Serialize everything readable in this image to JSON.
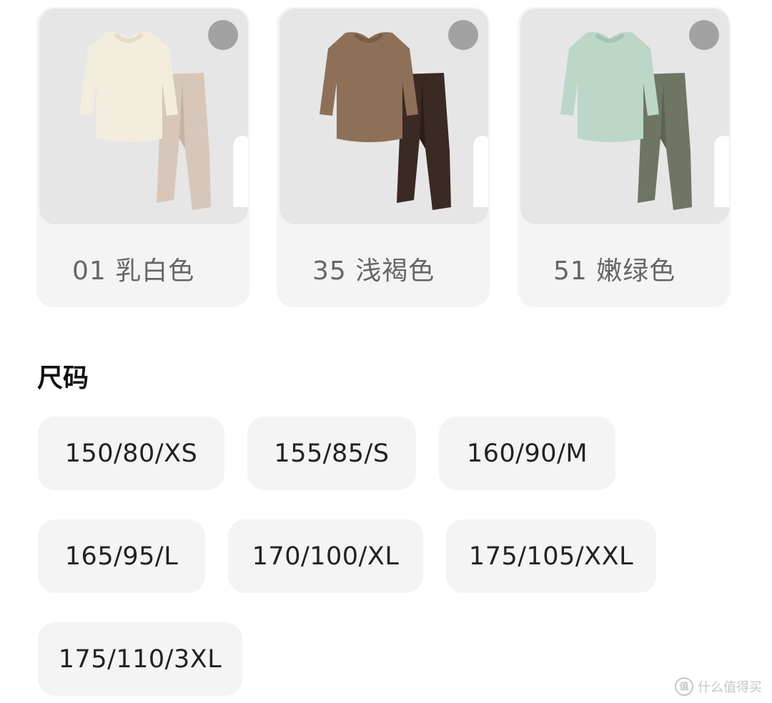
{
  "colors": [
    {
      "label": "01 乳白色",
      "top_color": "#f2eddd",
      "top_shade": "#e3dcc7",
      "bottom_color": "#d8c7b8",
      "bottom_shade": "#c4b2a3",
      "expand_icon": "expand-icon"
    },
    {
      "label": "35 浅褐色",
      "top_color": "#8e7058",
      "top_shade": "#7a5d47",
      "bottom_color": "#3b2924",
      "bottom_shade": "#2c1d19",
      "expand_icon": "expand-icon"
    },
    {
      "label": "51 嫩绿色",
      "top_color": "#bcd7c8",
      "top_shade": "#a6c4b3",
      "bottom_color": "#6e7663",
      "bottom_shade": "#5c6452",
      "expand_icon": "expand-icon"
    }
  ],
  "size_section": {
    "title": "尺码",
    "sizes": [
      "150/80/XS",
      "155/85/S",
      "160/90/M",
      "165/95/L",
      "170/100/XL",
      "175/105/XXL",
      "175/110/3XL"
    ]
  },
  "watermark": {
    "icon_text": "值",
    "text": "什么值得买"
  }
}
